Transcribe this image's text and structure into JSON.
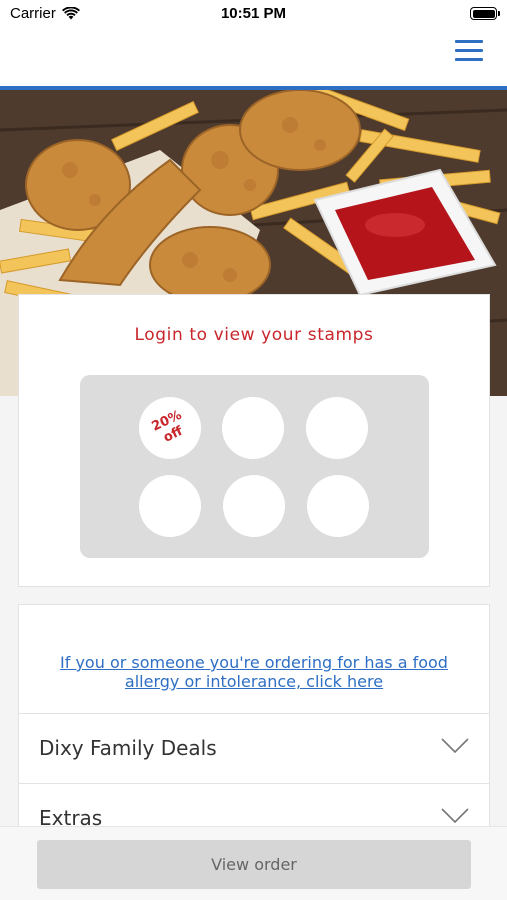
{
  "status_bar": {
    "carrier": "Carrier",
    "time": "10:51 PM",
    "icons": [
      "wifi-icon",
      "battery-icon"
    ]
  },
  "nav": {
    "menu_icon": "hamburger-menu-icon",
    "accent_color": "#2e6fc4"
  },
  "hero": {
    "image": "fried-chicken-fries-ketchup-photo"
  },
  "stamp_card": {
    "title": "Login to view your stamps",
    "title_color": "#c8262b",
    "reward_line1": "20%",
    "reward_line2": "off",
    "stamps_total": 6
  },
  "menu_card": {
    "allergy_link": "If you or someone you're ordering for has a food allergy or intolerance, click here",
    "sections": [
      {
        "label": "Dixy Family Deals",
        "icon": "chevron-down-icon"
      },
      {
        "label": "Extras",
        "icon": "chevron-down-icon"
      }
    ]
  },
  "bottom_bar": {
    "button_label": "View order"
  }
}
